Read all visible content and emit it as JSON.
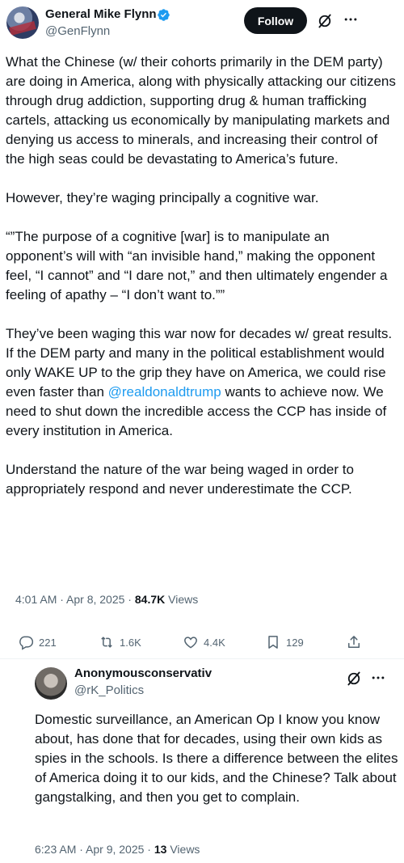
{
  "tweet": {
    "author_name": "General Mike Flynn",
    "author_handle": "@GenFlynn",
    "follow_label": "Follow",
    "para1": "What the Chinese (w/ their cohorts primarily in the DEM party) are doing in America, along with physically attacking our citizens through drug addiction, supporting drug & human trafficking cartels, attacking us economically by manipulating markets and denying us access to minerals, and increasing their control of the high seas could be devastating to America’s future.",
    "para2": "However, they’re waging principally a cognitive war.",
    "para3": "“”The purpose of a cognitive [war] is to manipulate an opponent’s will with “an invisible hand,” making the opponent feel, “I cannot” and “I dare not,” and then ultimately engender a feeling of apathy – “I don’t want to.””",
    "para4_before": "They’ve been waging this war now for decades w/ great results. If the DEM party and many in the political establishment would only WAKE UP to the grip they have on America, we could rise even faster than ",
    "para4_mention": "@realdonaldtrump",
    "para4_after": " wants to achieve now. We need to shut down the incredible access the CCP has inside of every institution in America.",
    "para5": "Understand the nature of the war being waged in order to appropriately respond and never underestimate the CCP.",
    "time": "4:01 AM · Apr 8, 2025 · ",
    "views_count": "84.7K",
    "views_label": " Views",
    "replies": "221",
    "reposts": "1.6K",
    "likes": "4.4K",
    "bookmarks": "129"
  },
  "reply": {
    "author_name": "Anonymousconservativ",
    "author_handle": "@rK_Politics",
    "text": "Domestic surveillance, an American Op I know you know about, has done that for decades, using their own kids as spies in the schools. Is there a difference between the elites of America doing it to our kids, and the Chinese? Talk about gangstalking, and then you get to complain.",
    "time": "6:23 AM · Apr 9, 2025 · ",
    "views_count": "13",
    "views_label": " Views"
  },
  "colors": {
    "accent": "#1d9bf0",
    "text": "#0f1419",
    "secondary": "#536471"
  }
}
